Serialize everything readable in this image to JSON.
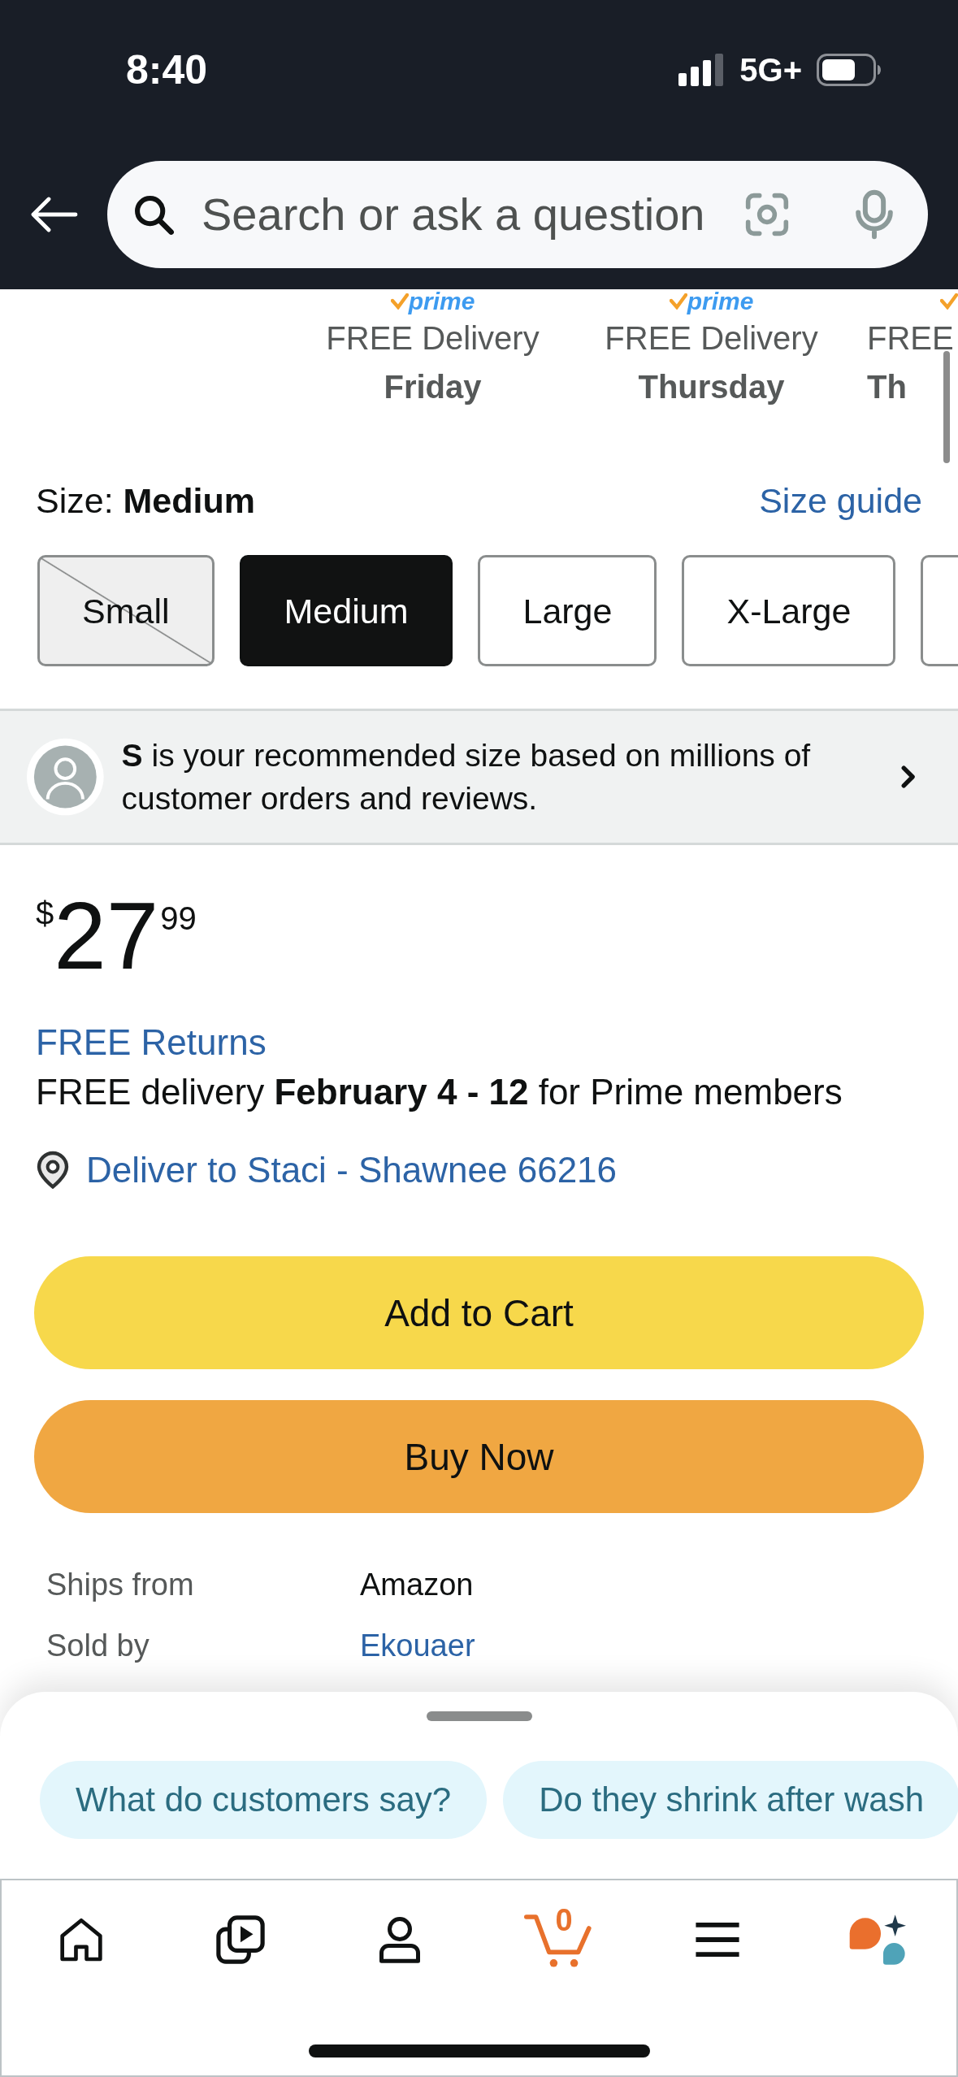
{
  "status_bar": {
    "time": "8:40",
    "network": "5G+"
  },
  "search": {
    "placeholder": "Search or ask a question"
  },
  "delivery_options": [
    {
      "kind": "full",
      "prime": true,
      "logo": "prime",
      "label": "FREE Delivery",
      "day": "Friday"
    },
    {
      "kind": "full",
      "prime": true,
      "logo": "prime",
      "label": "FREE Delivery",
      "day": "Thursday"
    },
    {
      "kind": "partial",
      "prime": true,
      "label": "FREE",
      "day": "Th"
    }
  ],
  "size": {
    "heading": "Size: **Medium**",
    "guide_link": "Size guide",
    "options": [
      {
        "label": "Small",
        "selected": false,
        "available": false
      },
      {
        "label": "Medium",
        "selected": true,
        "available": true
      },
      {
        "label": "Large",
        "selected": false,
        "available": true
      },
      {
        "label": "X-Large",
        "selected": false,
        "available": true
      },
      {
        "selected": false,
        "available": true
      }
    ]
  },
  "recommendation": {
    "text": "**S** is your recommended size based on millions of customer orders and reviews."
  },
  "price": {
    "currency": "$",
    "whole": "27",
    "fraction": "99"
  },
  "returns_link": "FREE Returns",
  "delivery_text": "FREE delivery **February 4 - 12** for Prime members",
  "location": "Deliver to Staci - Shawnee 66216",
  "buttons": [
    {
      "kind": "cart",
      "label": "Add to Cart"
    },
    {
      "kind": "buy",
      "label": "Buy Now"
    }
  ],
  "seller_info": [
    {
      "label": "Ships from",
      "value": "Amazon",
      "link": false
    },
    {
      "label": "Sold by",
      "value": "Ekouaer",
      "link": true
    }
  ],
  "suggestions": [
    "What do customers say?",
    "Do they shrink after wash"
  ],
  "nav": [
    {
      "kind": "home"
    },
    {
      "kind": "video"
    },
    {
      "kind": "account"
    },
    {
      "kind": "cart",
      "badge": "0"
    },
    {
      "kind": "menu"
    },
    {
      "kind": "assistant"
    }
  ]
}
